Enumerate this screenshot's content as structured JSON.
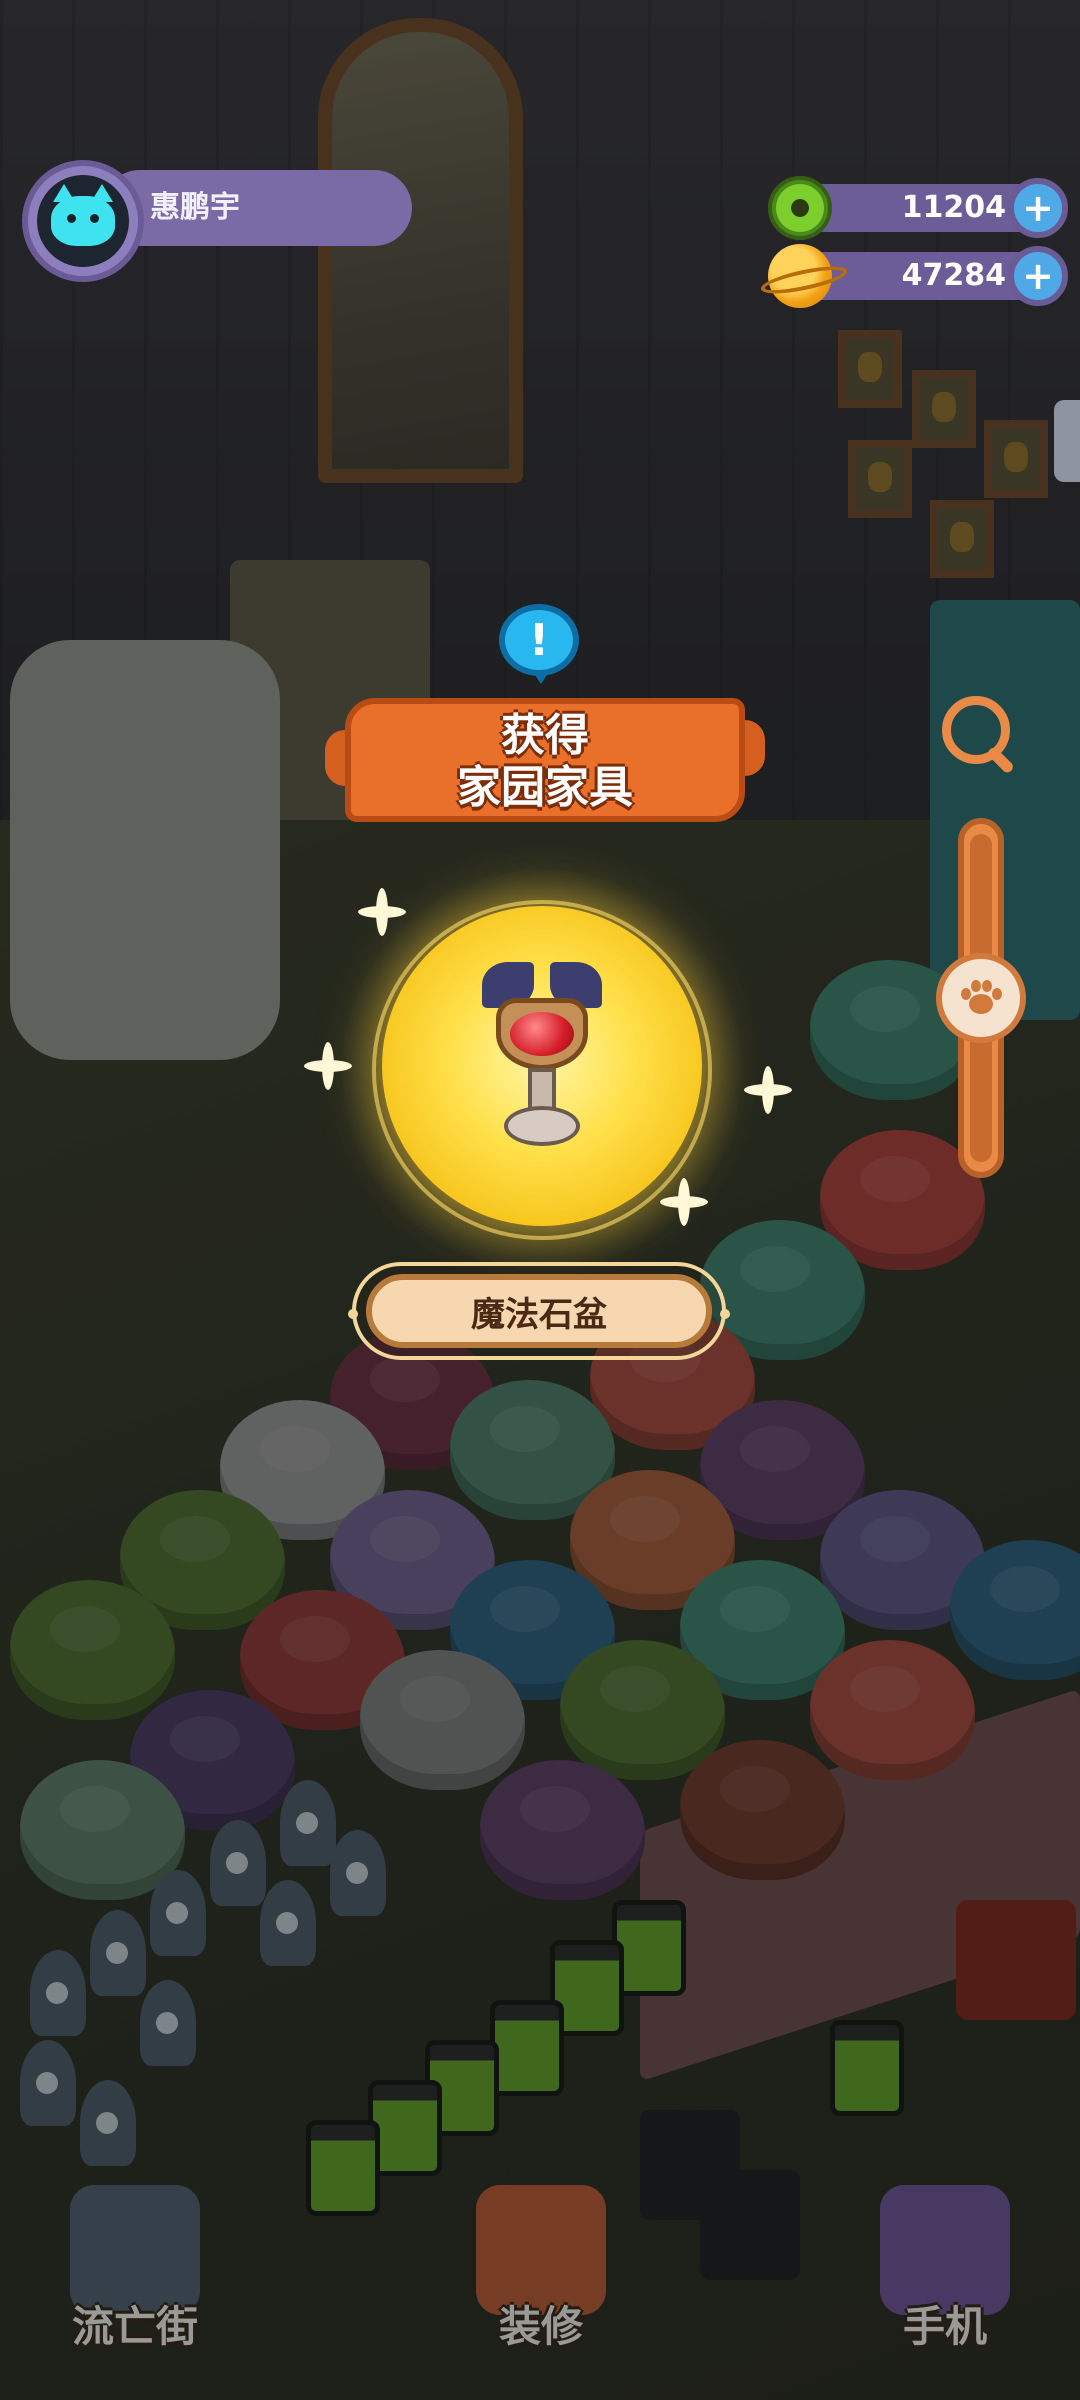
{
  "profile": {
    "username": "惠鹏宇",
    "avatar_icon": "cat-face-icon"
  },
  "currencies": [
    {
      "name": "donut",
      "icon": "donut-icon",
      "value": "11204"
    },
    {
      "name": "planet",
      "icon": "planet-coin-icon",
      "value": "47284"
    }
  ],
  "reward_popup": {
    "banner_line1": "获得",
    "banner_line2": "家园家具",
    "alert_symbol": "!",
    "item_name": "魔法石盆"
  },
  "zoom": {
    "level": 0.5
  },
  "bottom_nav": [
    {
      "label": "流亡街",
      "icon": "street-icon"
    },
    {
      "label": "装修",
      "icon": "decorate-icon"
    },
    {
      "label": "手机",
      "icon": "phone-icon"
    }
  ],
  "colors": {
    "accent_orange": "#e8702a",
    "pill_purple": "#7a6aa6",
    "glow_yellow": "#ffe04a",
    "plus_blue": "#4fa9e6"
  }
}
